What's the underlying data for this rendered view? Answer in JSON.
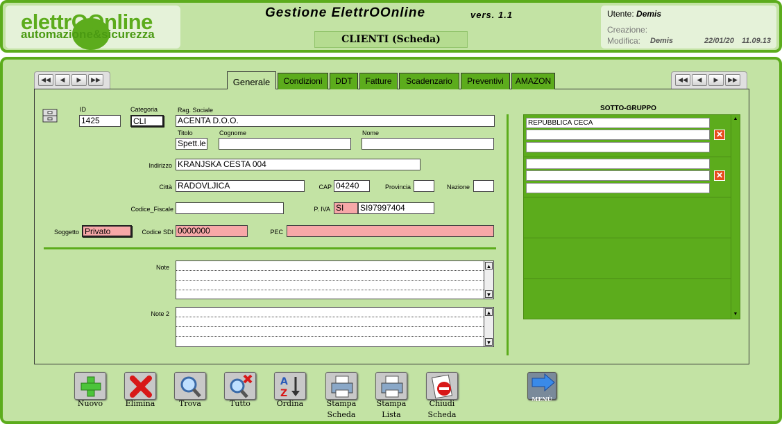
{
  "header": {
    "logo_line1": "elettrOOnline",
    "logo_line2": "automazione&sicurezza",
    "app_title": "Gestione  ElettrOOnline",
    "version": "vers. 1.1",
    "form_title": "CLIENTI  (Scheda)"
  },
  "user": {
    "utente_label": "Utente:",
    "utente_value": "Demis",
    "creazione_label": "Creazione:",
    "modifica_label": "Modifica:",
    "modifica_user": "Demis",
    "modifica_date": "22/01/20",
    "modifica_time": "11.09.13"
  },
  "nav": {
    "first": "◀◀",
    "prev": "◀",
    "next": "▶",
    "last": "▶▶"
  },
  "tabs": [
    "Generale",
    "Condizioni",
    "DDT",
    "Fatture",
    "Scadenzario",
    "Preventivi",
    "AMAZON"
  ],
  "form": {
    "id_label": "ID",
    "id_value": "1425",
    "categoria_label": "Categoria",
    "categoria_value": "CLI",
    "rag_sociale_label": "Rag. Sociale",
    "rag_sociale_value": "ACENTA D.O.O.",
    "titolo_label": "Titolo",
    "titolo_value": "Spett.le",
    "cognome_label": "Cognome",
    "cognome_value": "",
    "nome_label": "Nome",
    "nome_value": "",
    "indirizzo_label": "Indirizzo",
    "indirizzo_value": "KRANJSKA CESTA 004",
    "citta_label": "Città",
    "citta_value": "RADOVLJICA",
    "cap_label": "CAP",
    "cap_value": "04240",
    "provincia_label": "Provincia",
    "provincia_value": "",
    "nazione_label": "Nazione",
    "nazione_value": "",
    "cf_label": "Codice_Fiscale",
    "cf_value": "",
    "piva_label": "P. IVA",
    "piva_prefix": "SI",
    "piva_value": "SI97997404",
    "soggetto_label": "Soggetto",
    "soggetto_value": "Privato",
    "sdi_label": "Codice  SDI",
    "sdi_value": "0000000",
    "pec_label": "PEC",
    "pec_value": "",
    "note_label": "Note",
    "note2_label": "Note 2"
  },
  "sottogruppo": {
    "title": "SOTTO-GRUPPO",
    "row1_value": "REPUBBLICA CECA",
    "delete_symbol": "✕"
  },
  "toolbar": {
    "nuovo": "Nuovo",
    "elimina": "Elimina",
    "trova": "Trova",
    "tutto": "Tutto",
    "ordina": "Ordina",
    "stampa_scheda_1": "Stampa",
    "stampa_scheda_2": "Scheda",
    "stampa_lista_1": "Stampa",
    "stampa_lista_2": "Lista",
    "chiudi_scheda_1": "Chiudi",
    "chiudi_scheda_2": "Scheda",
    "menu": "MENÙ"
  },
  "colors": {
    "accent": "#5cac1c",
    "panel": "#c3e3a4",
    "pink": "#f7a8a8",
    "delete": "#e84c1c"
  }
}
